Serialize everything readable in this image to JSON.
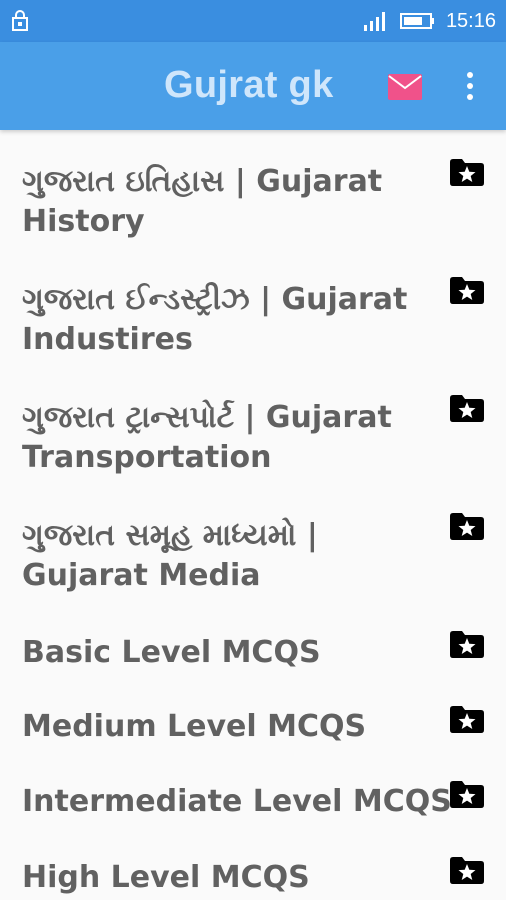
{
  "status_bar": {
    "time": "15:16",
    "icons": [
      "lock-icon",
      "signal-icon",
      "battery-icon"
    ]
  },
  "app_bar": {
    "title": "Gujrat gk",
    "actions": [
      "mail-icon",
      "more-vert-icon"
    ],
    "colors": {
      "mail": "#f0528a",
      "bar": "#4a9fe8",
      "status": "#3a8ee0"
    }
  },
  "items": [
    {
      "label": "ગુજરાત ઇતિહાસ | Gujarat History",
      "icon": "folder-star-icon"
    },
    {
      "label": "ગુજરાત ઈન્ડસ્ટ્રીઝ | Gujarat Industires",
      "icon": "folder-star-icon"
    },
    {
      "label": "ગુજરાત ટ્રાન્સપોર્ટ | Gujarat Transportation",
      "icon": "folder-star-icon"
    },
    {
      "label": "ગુજરાત સમૂહ માધ્યમો | Gujarat Media",
      "icon": "folder-star-icon"
    },
    {
      "label": "Basic Level MCQS",
      "icon": "folder-star-icon"
    },
    {
      "label": "Medium Level MCQS",
      "icon": "folder-star-icon"
    },
    {
      "label": "Intermediate Level MCQS",
      "icon": "folder-star-icon"
    },
    {
      "label": "High Level MCQS",
      "icon": "folder-star-icon"
    }
  ]
}
